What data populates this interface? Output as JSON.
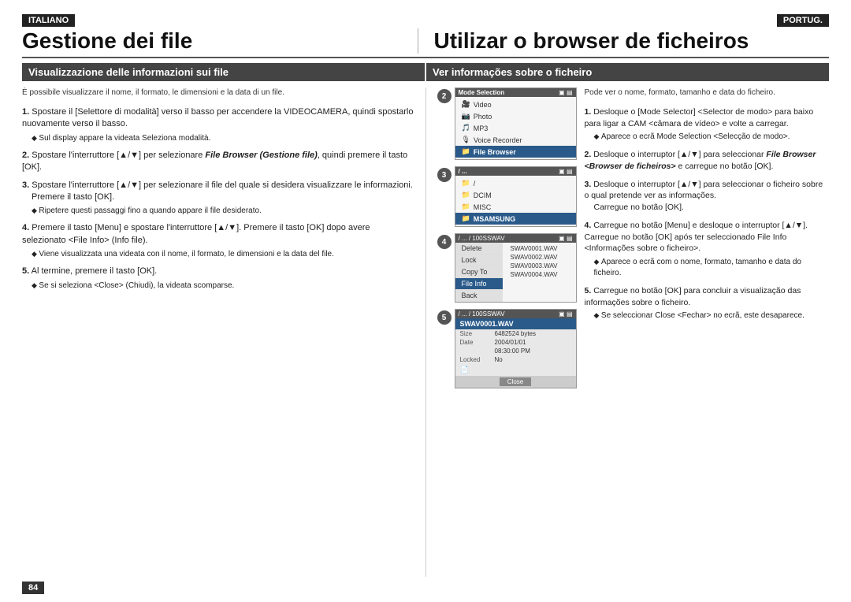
{
  "header": {
    "lang_it": "ITALIANO",
    "lang_pt": "PORTUG.",
    "title_it": "Gestione dei file",
    "title_pt": "Utilizar o browser de ficheiros"
  },
  "sections": {
    "section_it": "Visualizzazione delle informazioni sui file",
    "section_pt": "Ver informações sobre o ficheiro"
  },
  "intro": {
    "it": "È possibile visualizzare il nome, il formato, le dimensioni e la data di un file.",
    "pt": "Pode ver o nome, formato, tamanho e data do ficheiro."
  },
  "steps_it": [
    {
      "num": "1.",
      "text": "Spostare il [Selettore di modalità] verso il basso per accendere la VIDEOCAMERA, quindi spostarlo nuovamente verso il basso.",
      "bullet": "Sul display appare la videata Seleziona modalità."
    },
    {
      "num": "2.",
      "text": "Spostare l'interruttore [▲/▼] per selezionare File Browser (Gestione file), quindi premere il tasto [OK].",
      "bullet": null
    },
    {
      "num": "3.",
      "text": "Spostare l'interruttore [▲/▼] per selezionare il file del quale si desidera visualizzare le informazioni.",
      "sub": "Premere il tasto [OK].",
      "bullet": "Ripetere questi passaggi fino a quando appare il file desiderato."
    },
    {
      "num": "4.",
      "text": "Premere il tasto [Menu] e spostare l'interruttore [▲/▼]. Premere il tasto [OK] dopo avere selezionato <File Info> (Info file).",
      "bullet": "Viene visualizzata una videata con il nome, il formato, le dimensioni e la data del file."
    },
    {
      "num": "5.",
      "text": "Al termine, premere il tasto [OK].",
      "bullet": "Se si seleziona <Close> (Chiudi), la videata scomparse."
    }
  ],
  "steps_pt": [
    {
      "num": "1.",
      "text": "Desloque o [Mode Selector] <Selector de modo> para baixo para ligar a CAM <câmara de vídeo> e volte a carregar.",
      "bullet": "Aparece o ecrã Mode Selection <Selecção de modo>."
    },
    {
      "num": "2.",
      "text": "Desloque o interruptor [▲/▼] para seleccionar File Browser <Browser de ficheiros> e carregue no botão [OK].",
      "bullet": null
    },
    {
      "num": "3.",
      "text": "Desloque o interruptor [▲/▼] para seleccionar o ficheiro sobre o qual pretende ver as informações.",
      "sub": "Carregue no botão [OK].",
      "bullet": null
    },
    {
      "num": "4.",
      "text": "Carregue no botão [Menu] e desloque o interruptor [▲/▼]. Carregue no botão [OK] após ter seleccionado File Info <Informações sobre o ficheiro>.",
      "bullet": "Aparece o ecrã com o nome, formato, tamanho e data do ficheiro."
    },
    {
      "num": "5.",
      "text": "Carregue no botão [OK] para concluir a visualização das informações sobre o ficheiro.",
      "bullet": "Se seleccionar Close <Fechar> no ecrã, este desaparece."
    }
  ],
  "screen2": {
    "title": "Mode Selection",
    "items": [
      "Video",
      "Photo",
      "MP3",
      "Voice Recorder",
      "File Browser"
    ],
    "selected": 4
  },
  "screen3": {
    "path": "/ ...",
    "items": [
      "/",
      "DCIM",
      "MISC",
      "MSAMSUNG"
    ],
    "selected": 3
  },
  "screen4": {
    "path": "/ ... / 100SSWAV",
    "menu_items": [
      "Delete",
      "Lock",
      "Copy To",
      "File Info",
      "Back"
    ],
    "files": [
      "SWAV0001.WAV",
      "SWAV0002.WAV",
      "SWAV0003.WAV",
      "SWAV0004.WAV"
    ],
    "selected_menu": 3
  },
  "screen5": {
    "path": "/ ... / 100SSWAV",
    "filename": "SWAV0001.WAV",
    "size_label": "Size",
    "size_value": "6482524 bytes",
    "date_label": "Date",
    "date_value": "2004/01/01",
    "time_value": "08:30:00 PM",
    "locked_label": "Locked",
    "locked_value": "No",
    "close_label": "Close"
  },
  "footer": {
    "page_number": "84"
  }
}
